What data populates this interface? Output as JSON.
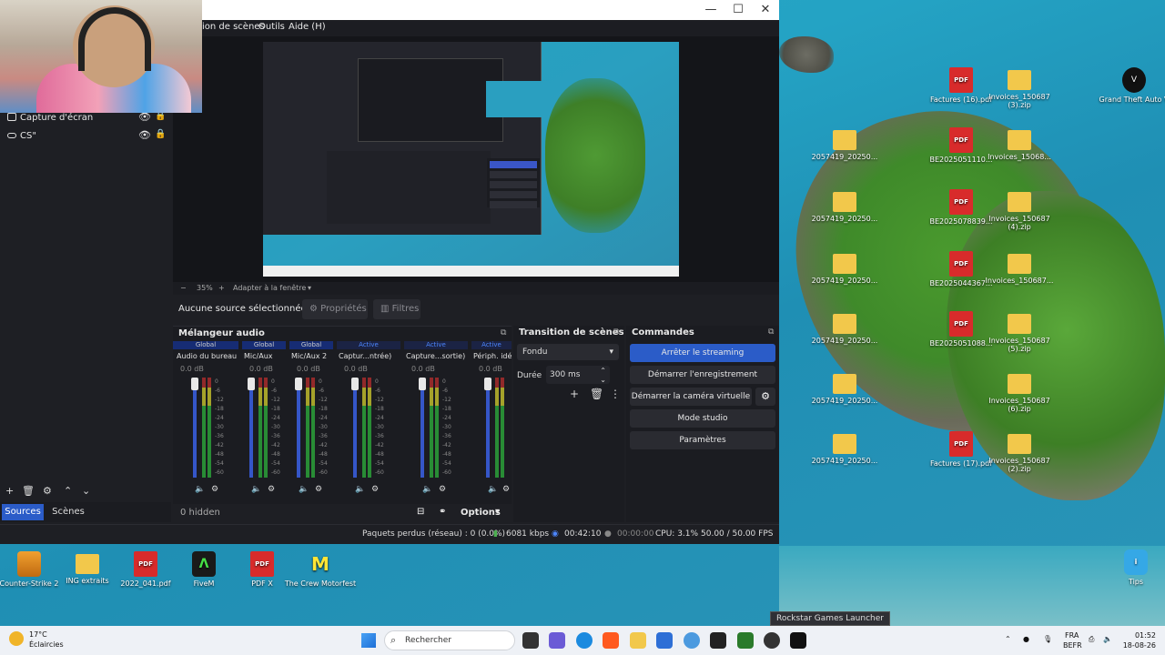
{
  "obs": {
    "menu": [
      "ion de scènes",
      "Outils",
      "Aide (H)"
    ],
    "window_controls": [
      "—",
      "☐",
      "✕"
    ],
    "preview_zoom": {
      "percent": "35%",
      "fit": "Adapter à la fenêtre"
    },
    "selection": {
      "no_source": "Aucune source sélectionnée",
      "properties": "Propriétés",
      "filters": "Filtres"
    },
    "sources": [
      {
        "label": "Capture d'écran",
        "icon": "monitor-icon"
      },
      {
        "label": "CS\"",
        "icon": "game-capture-icon"
      }
    ],
    "tabs": {
      "sources": "Sources",
      "scenes": "Scènes"
    },
    "mixer": {
      "title": "Mélangeur audio",
      "hidden": "0 hidden",
      "options": "Options",
      "channels": [
        {
          "tag": "Global",
          "name": "Audio du bureau",
          "db": "0.0 dB",
          "level": 0.72
        },
        {
          "tag": "Global",
          "name": "Mic/Aux",
          "db": "0.0 dB",
          "level": 0.6
        },
        {
          "tag": "Global",
          "name": "Mic/Aux 2",
          "db": "0.0 dB",
          "level": 0.6
        },
        {
          "tag": "Active",
          "name": "Captur...ntrée)",
          "db": "0.0 dB",
          "level": 0.5
        },
        {
          "tag": "Active",
          "name": "Capture...sortie)",
          "db": "0.0 dB",
          "level": 0.55
        },
        {
          "tag": "Active",
          "name": "Périph. idéc",
          "db": "0.0 dB",
          "level": 0.5
        }
      ],
      "scale": [
        "0",
        "-6",
        "-12",
        "-18",
        "-24",
        "-30",
        "-36",
        "-42",
        "-48",
        "-54",
        "-60"
      ]
    },
    "transition": {
      "title": "Transition de scènes",
      "selected": "Fondu",
      "duration_label": "Durée",
      "duration_value": "300 ms"
    },
    "controls": {
      "title": "Commandes",
      "buttons": [
        "Arrêter le streaming",
        "Démarrer l'enregistrement",
        "Démarrer la caméra virtuelle",
        "Mode studio",
        "Paramètres"
      ]
    },
    "status": {
      "dropped": "Paquets perdus (réseau) : 0 (0.0%)",
      "bitrate": "6081 kbps",
      "stream_time": "00:42:10",
      "rec_time": "00:00:00",
      "cpu": "CPU: 3.1%",
      "fps": "50.00 / 50.00 FPS"
    }
  },
  "desktop": {
    "icons_right": [
      {
        "label": "Factures (16).pdf",
        "type": "pdf"
      },
      {
        "label": "Invoices_150687 (3).zip",
        "type": "folder"
      },
      {
        "label": "Grand Theft Auto V",
        "type": "gta"
      },
      {
        "label": "2057419_20250...",
        "type": "folder"
      },
      {
        "label": "BE2025051110...",
        "type": "pdf"
      },
      {
        "label": "Invoices_15068...",
        "type": "folder"
      },
      {
        "label": "2057419_20250...",
        "type": "folder"
      },
      {
        "label": "BE2025078839...",
        "type": "pdf"
      },
      {
        "label": "Invoices_150687 (4).zip",
        "type": "folder"
      },
      {
        "label": "2057419_20250...",
        "type": "folder"
      },
      {
        "label": "BE2025044367...",
        "type": "pdf"
      },
      {
        "label": "Invoices_150687...",
        "type": "folder"
      },
      {
        "label": "2057419_20250...",
        "type": "folder"
      },
      {
        "label": "BE2025051088...",
        "type": "pdf"
      },
      {
        "label": "Invoices_150687 (5).zip",
        "type": "folder"
      },
      {
        "label": "2057419_20250...",
        "type": "folder"
      },
      {
        "label": "Invoices_150687 (6).zip",
        "type": "folder"
      },
      {
        "label": "2057419_20250...",
        "type": "folder"
      },
      {
        "label": "Factures (17).pdf",
        "type": "pdf"
      },
      {
        "label": "Invoices_150687 (2).zip",
        "type": "folder"
      }
    ],
    "icons_bottom": [
      {
        "label": "Counter-Strike 2",
        "type": "cs"
      },
      {
        "label": "ING extraits",
        "type": "folder"
      },
      {
        "label": "2022_041.pdf",
        "type": "pdf"
      },
      {
        "label": "FiveM",
        "type": "app"
      },
      {
        "label": "PDF X",
        "type": "pdf"
      },
      {
        "label": "The Crew Motorfest",
        "type": "crew"
      }
    ],
    "icon_right_bottom": "Tips",
    "tooltip": "Rockstar Games Launcher"
  },
  "taskbar": {
    "weather_temp": "17°C",
    "weather_desc": "Éclaircies",
    "search_placeholder": "Rechercher",
    "lang1": "FRA",
    "lang2": "BEFR",
    "time": "01:52",
    "date": "18-08-26"
  }
}
